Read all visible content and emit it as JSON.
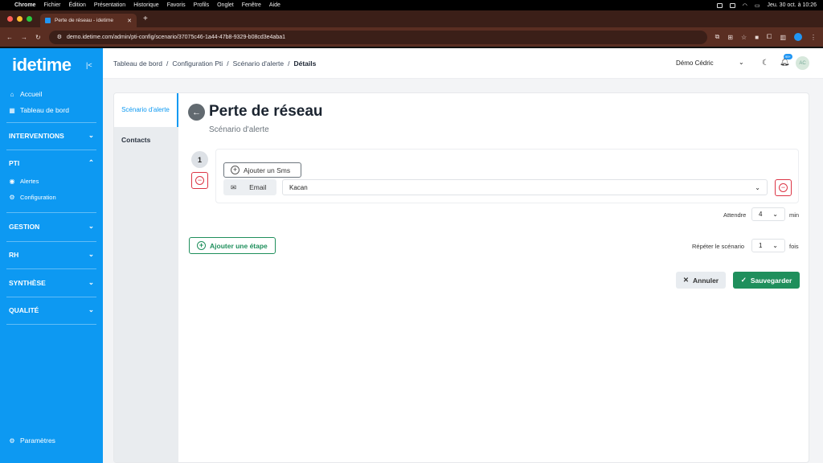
{
  "menubar": {
    "app": "Chrome",
    "items": [
      "Fichier",
      "Édition",
      "Présentation",
      "Historique",
      "Favoris",
      "Profils",
      "Onglet",
      "Fenêtre",
      "Aide"
    ],
    "clock": "Jeu. 30 oct. à  10:26"
  },
  "browser": {
    "tab_title": "Perte de réseau - idetime",
    "url": "demo.idetime.com/admin/pti-config/scenario/37075c46-1a44-47b8-9329-b08cd3e4aba1"
  },
  "sidebar": {
    "logo": "idetime",
    "accueil": "Accueil",
    "tableau": "Tableau de bord",
    "interventions": "INTERVENTIONS",
    "pti": "PTI",
    "alertes": "Alertes",
    "configuration": "Configuration",
    "gestion": "GESTION",
    "rh": "RH",
    "synthese": "SYNTHÈSE",
    "qualite": "QUALITÉ",
    "parametres": "Paramètres"
  },
  "topbar": {
    "crumbs": [
      "Tableau de bord",
      "Configuration Pti",
      "Scénario d'alerte",
      "Détails"
    ],
    "user": "Démo Cédric",
    "avatar": "AC",
    "badge": "99+"
  },
  "leftnav": {
    "active": "Scénario d'alerte",
    "contacts": "Contacts"
  },
  "page": {
    "title": "Perte de réseau",
    "subtitle": "Scénario d'alerte",
    "step_number": "1",
    "add_sms": "Ajouter un Sms",
    "email_label": "Email",
    "contact_value": "Kacan",
    "attendre_label": "Attendre",
    "attendre_value": "4",
    "attendre_unit": "min",
    "add_step": "Ajouter une étape",
    "repeat_label": "Répéter le scénario",
    "repeat_value": "1",
    "repeat_unit": "fois",
    "cancel": "Annuler",
    "save": "Sauvegarder"
  },
  "colors": {
    "sidebar": "#0d99f2",
    "primary_green": "#1f8f5c",
    "danger": "#dc3545"
  }
}
